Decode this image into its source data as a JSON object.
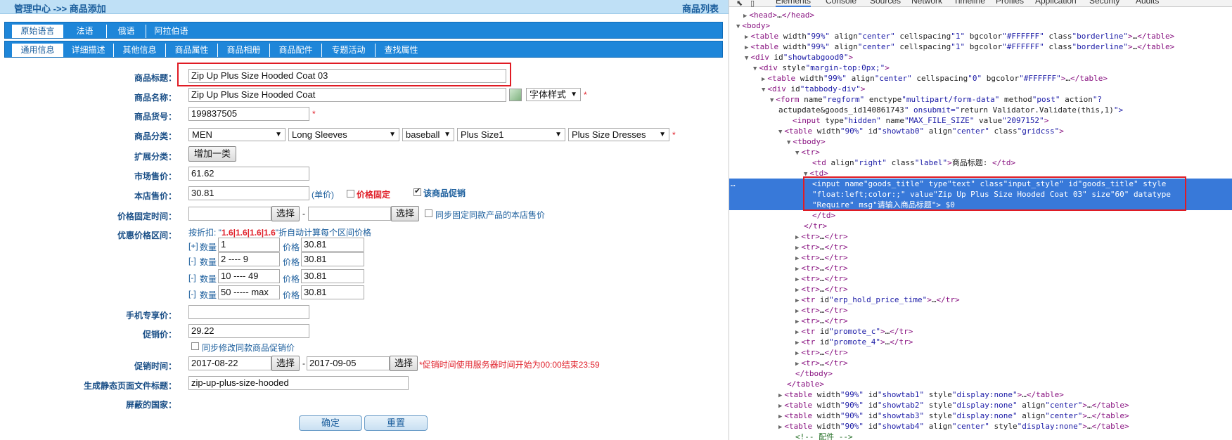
{
  "header": {
    "breadcrumb": "管理中心 ->> 商品添加",
    "list_link": "商品列表"
  },
  "lang_tabs": [
    "原始语言",
    "法语",
    "俄语",
    "阿拉伯语"
  ],
  "section_tabs": [
    "通用信息",
    "详细描述",
    "其他信息",
    "商品属性",
    "商品相册",
    "商品配件",
    "专题活动",
    "查找属性"
  ],
  "form": {
    "goods_title": {
      "label": "商品标题：",
      "value": "Zip Up Plus Size Hooded Coat 03"
    },
    "goods_name": {
      "label": "商品名称：",
      "value": "Zip Up Plus Size Hooded Coat",
      "font_style": "字体样式",
      "star": "*"
    },
    "goods_sn": {
      "label": "商品货号：",
      "value": "199837505",
      "star": "*"
    },
    "category": {
      "label": "商品分类：",
      "options": [
        "MEN",
        "Long Sleeves",
        "baseball",
        "Plus Size1",
        "Plus Size Dresses"
      ],
      "star": "*"
    },
    "ext_category": {
      "label": "扩展分类：",
      "button": "增加一类"
    },
    "market_price": {
      "label": "市场售价：",
      "value": "61.62"
    },
    "shop_price": {
      "label": "本店售价：",
      "value": "30.81",
      "unit": "(单价)",
      "fixed_label": "价格固定",
      "promo_label": "该商品促销"
    },
    "fixed_time": {
      "label": "价格固定时间：",
      "select": "选择",
      "dash": "-",
      "sync_label": "同步固定同款产品的本店售价"
    },
    "discount": {
      "label": "优惠价格区间：",
      "hint_prefix": "按折扣: \"",
      "hint_value": "1.6|1.6|1.6|1.6",
      "hint_suffix": "\"折自动计算每个区间价格",
      "rows": [
        {
          "sign": "[+]",
          "qty_label": "数量",
          "qty": "1",
          "price_label": "价格",
          "price": "30.81"
        },
        {
          "sign": "[-]",
          "qty_label": "数量",
          "qty": "2 ---- 9",
          "price_label": "价格",
          "price": "30.81"
        },
        {
          "sign": "[-]",
          "qty_label": "数量",
          "qty": "10 ---- 49",
          "price_label": "价格",
          "price": "30.81"
        },
        {
          "sign": "[-]",
          "qty_label": "数量",
          "qty": "50 ----- max",
          "price_label": "价格",
          "price": "30.81"
        }
      ]
    },
    "mobile_price": {
      "label": "手机专享价：",
      "value": ""
    },
    "promo_price": {
      "label": "促销价：",
      "value": "29.22",
      "sync_label": "同步修改同款商品促销价"
    },
    "promo_time": {
      "label": "促销时间：",
      "start": "2017-08-22",
      "end": "2017-09-05",
      "select": "选择",
      "dash": "-",
      "note": "*促销时间使用服务器时间开始为00:00结束23:59"
    },
    "static_page": {
      "label": "生成静态页面文件标题：",
      "value": "zip-up-plus-size-hooded"
    },
    "blocked_country": {
      "label": "屏蔽的国家："
    },
    "ok_button": "确定",
    "reset_button": "重置"
  },
  "devtools": {
    "tabs": [
      "Elements",
      "Console",
      "Sources",
      "Network",
      "Timeline",
      "Profiles",
      "Application",
      "Security",
      "Audits"
    ],
    "lines": [
      "<head>…</head>",
      "<body>",
      "<table width=\"99%\" align=\"center\" cellspacing=\"1\" bgcolor=\"#FFFFFF\" class=\"borderline\">…</table>",
      "<table width=\"99%\" align=\"center\" cellspacing=\"1\" bgcolor=\"#FFFFFF\" class=\"borderline\">…</table>",
      "<div id=\"showtabgood0\">",
      "<div style=\"margin-top:0px;\">",
      "<table width=\"99%\" align=\"center\" cellspacing=\"0\" bgcolor=\"#FFFFFF\">…</table>",
      "<div id=\"tabbody-div\">",
      "<form name=\"regform\" enctype=\"multipart/form-data\" method=\"post\" action=\"?",
      "act=update&goods_id=140861743\" onsubmit=\"return Validator.Validate(this,1)\">",
      "<input type=\"hidden\" name=\"MAX_FILE_SIZE\" value=\"2097152\">",
      "<table width=\"90%\" id=\"showtab0\" align=\"center\" class=\"gridcss\">",
      "<tbody>",
      "<tr>",
      "<td align=\"right\" class=\"label\">商品标题: </td>",
      "<td>",
      "</td>",
      "</tr>",
      "<tr>…</tr>",
      "<tr>…</tr>",
      "<tr>…</tr>",
      "<tr>…</tr>",
      "<tr>…</tr>",
      "<tr>…</tr>",
      "<tr id=\"erp_hold_price_time\">…</tr>",
      "<tr>…</tr>",
      "<tr>…</tr>",
      "<tr id=\"promote_c\">…</tr>",
      "<tr id=\"promote_4\">…</tr>",
      "<tr>…</tr>",
      "<tr>…</tr>",
      "</tbody>",
      "</table>",
      "<table width=\"99%\" id=\"showtab1\" style=\"display:none\">…</table>",
      "<table width=\"90%\" id=\"showtab2\" style=\"display:none\" align=\"center\">…</table>",
      "<table width=\"90%\" id=\"showtab3\" style=\"display:none\" align=\"center\">…</table>",
      "<table width=\"90%\" id=\"showtab4\" align=\"center\" style=\"display:none\">…</table>",
      "<!-- 配件 -->"
    ],
    "selected_line_1": "<input name=\"goods_title\" type=\"text\" class=\"input_style\" id=\"goods_title\" style=",
    "selected_line_2": "\"float:left;color:;\" value=\"Zip Up Plus Size Hooded Coat 03\" size=\"60\" datatype=",
    "selected_line_3": "\"Require\" msg=\"请输入商品标题\"> == $0",
    "ellipsis": "…"
  },
  "colors": {
    "accent": "#1e86d9",
    "highlight": "#3879d9",
    "error": "#e01b24"
  }
}
